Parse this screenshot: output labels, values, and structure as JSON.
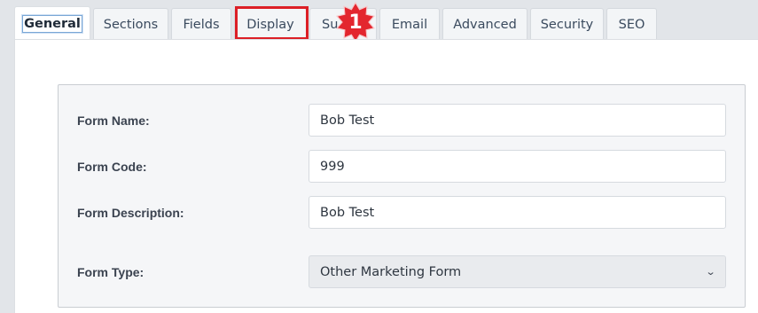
{
  "tabs": [
    {
      "label": "General",
      "active": true
    },
    {
      "label": "Sections"
    },
    {
      "label": "Fields"
    },
    {
      "label": "Display",
      "highlighted": true
    },
    {
      "label": "Su"
    },
    {
      "label": "Email"
    },
    {
      "label": "Advanced"
    },
    {
      "label": "Security"
    },
    {
      "label": "SEO"
    }
  ],
  "callout": {
    "number": "1",
    "color": "#e3262e"
  },
  "form": {
    "name_label": "Form Name:",
    "name_value": "Bob Test",
    "code_label": "Form Code:",
    "code_value": "999",
    "description_label": "Form Description:",
    "description_value": "Bob Test",
    "type_label": "Form Type:",
    "type_value": "Other Marketing Form"
  },
  "icons": {
    "select_arrow": "chevron-down-icon"
  }
}
